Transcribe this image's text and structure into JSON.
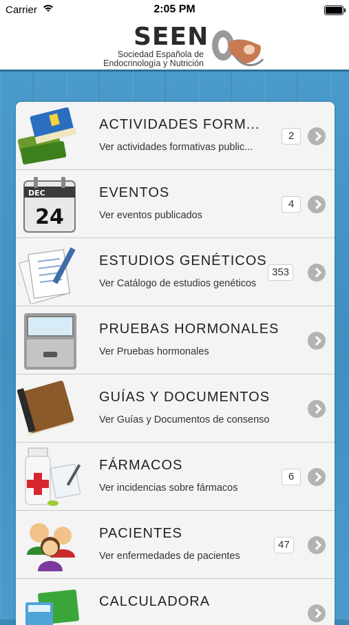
{
  "status_bar": {
    "carrier": "Carrier",
    "time": "2:05 PM",
    "wifi_icon": "wifi-icon",
    "battery_icon": "battery-icon"
  },
  "header": {
    "logo_title": "SEEN",
    "logo_subtitle_line1": "Sociedad Española de",
    "logo_subtitle_line2": "Endocrinología y Nutrición"
  },
  "menu": [
    {
      "id": "actividades",
      "title": "ACTIVIDADES FORM...",
      "subtitle": "Ver actividades formativas public...",
      "badge": "2",
      "icon": "books-icon"
    },
    {
      "id": "eventos",
      "title": "EVENTOS",
      "subtitle": "Ver eventos publicados",
      "badge": "4",
      "icon": "calendar-icon",
      "calendar_month": "DEC",
      "calendar_day": "24"
    },
    {
      "id": "estudios",
      "title": "ESTUDIOS GENÉTICOS",
      "subtitle": "Ver Catálogo de estudios genéticos",
      "badge": "353",
      "icon": "documents-pen-icon"
    },
    {
      "id": "pruebas",
      "title": "PRUEBAS HORMONALES",
      "subtitle": "Ver Pruebas hormonales",
      "badge": "",
      "icon": "file-cabinet-icon"
    },
    {
      "id": "guias",
      "title": "GUÍAS Y DOCUMENTOS",
      "subtitle": "Ver Guías y Documentos de consenso",
      "badge": "",
      "icon": "book-icon"
    },
    {
      "id": "farmacos",
      "title": "FÁRMACOS",
      "subtitle": "Ver incidencias sobre fármacos",
      "badge": "6",
      "icon": "medicine-icon"
    },
    {
      "id": "pacientes",
      "title": "PACIENTES",
      "subtitle": "Ver enfermedades de pacientes",
      "badge": "47",
      "icon": "patients-icon"
    },
    {
      "id": "calculadora",
      "title": "CALCULADORA",
      "subtitle": "",
      "badge": "",
      "icon": "calculator-icon"
    }
  ],
  "colors": {
    "header_border": "#2f6f95",
    "background": "#4a9bcc",
    "row_bg": "#f4f4f4"
  }
}
